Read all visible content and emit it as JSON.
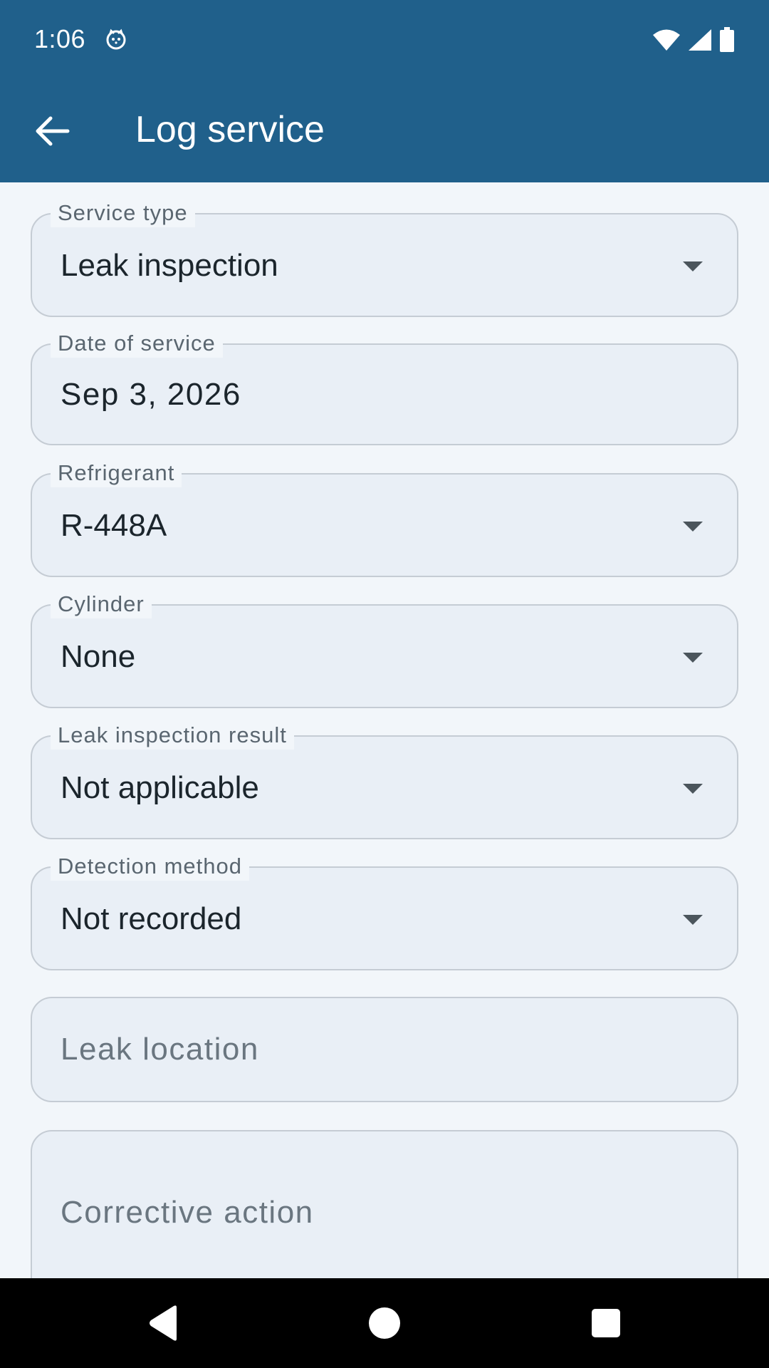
{
  "status_bar": {
    "time": "1:06",
    "app_icon": "cat-face-icon",
    "icons": [
      "wifi-icon",
      "signal-icon",
      "battery-icon"
    ]
  },
  "app_bar": {
    "back_icon": "arrow-left-icon",
    "title": "Log service"
  },
  "form": {
    "service_type": {
      "label": "Service type",
      "value": "Leak inspection"
    },
    "date_of_service": {
      "label": "Date of service",
      "value": "Sep 3, 2026"
    },
    "refrigerant": {
      "label": "Refrigerant",
      "value": "R-448A"
    },
    "cylinder": {
      "label": "Cylinder",
      "value": "None"
    },
    "leak_inspection_result": {
      "label": "Leak inspection result",
      "value": "Not applicable"
    },
    "detection_method": {
      "label": "Detection method",
      "value": "Not recorded"
    },
    "leak_location": {
      "placeholder": "Leak location"
    },
    "corrective_action": {
      "placeholder": "Corrective action"
    }
  },
  "nav_bar": {
    "icons": [
      "back-triangle-icon",
      "home-circle-icon",
      "recents-square-icon"
    ]
  },
  "colors": {
    "primary": "#20608b",
    "background": "#f2f6fa",
    "field_fill": "#e9eff6",
    "field_border": "#c5ccd4",
    "text": "#1b252c",
    "label": "#5a6670"
  }
}
